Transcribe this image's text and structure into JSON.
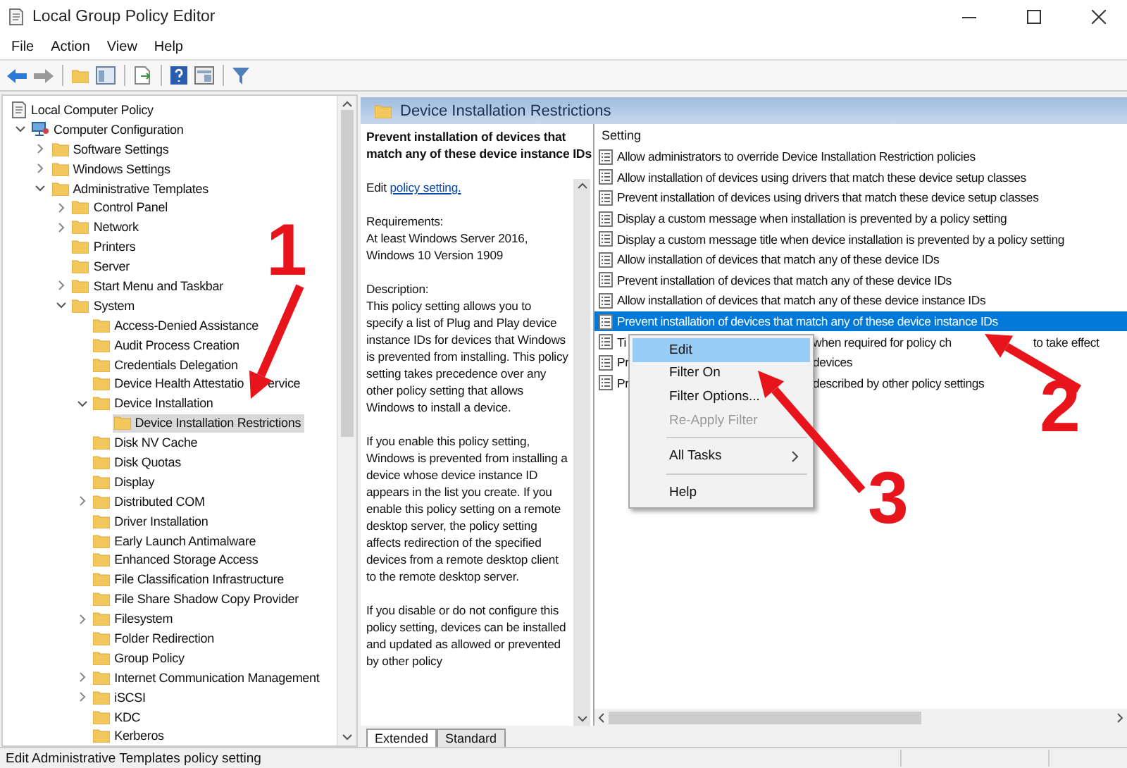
{
  "window": {
    "title": "Local Group Policy Editor"
  },
  "menu_bar": [
    "File",
    "Action",
    "View",
    "Help"
  ],
  "tree": [
    {
      "label": "Local Computer Policy",
      "kind": "policy",
      "selected": false,
      "children": [
        {
          "label": "Computer Configuration",
          "kind": "computer",
          "expanded": true,
          "selected": false,
          "children": [
            {
              "label": "Software Settings",
              "expanded": false,
              "selected": false
            },
            {
              "label": "Windows Settings",
              "expanded": false,
              "selected": false
            },
            {
              "label": "Administrative Templates",
              "expanded": true,
              "selected": false,
              "children": [
                {
                  "label": "Control Panel",
                  "expanded": false,
                  "selected": false
                },
                {
                  "label": "Network",
                  "expanded": false,
                  "selected": false
                },
                {
                  "label": "Printers",
                  "selected": false
                },
                {
                  "label": "Server",
                  "selected": false
                },
                {
                  "label": "Start Menu and Taskbar",
                  "expanded": false,
                  "selected": false
                },
                {
                  "label": "System",
                  "expanded": true,
                  "selected": false,
                  "children": [
                    {
                      "label": "Access-Denied Assistance",
                      "selected": false
                    },
                    {
                      "label": "Audit Process Creation",
                      "selected": false
                    },
                    {
                      "label": "Credentials Delegation",
                      "selected": false
                    },
                    {
                      "parts": [
                        "Device Health Attestatio",
                        "ervice"
                      ],
                      "selected": false
                    },
                    {
                      "label": "Device Installation",
                      "expanded": true,
                      "selected": false,
                      "children": [
                        {
                          "label": "Device Installation Restrictions",
                          "selected": true
                        }
                      ]
                    },
                    {
                      "label": "Disk NV Cache",
                      "selected": false
                    },
                    {
                      "label": "Disk Quotas",
                      "selected": false
                    },
                    {
                      "label": "Display",
                      "selected": false
                    },
                    {
                      "label": "Distributed COM",
                      "expanded": false,
                      "selected": false
                    },
                    {
                      "label": "Driver Installation",
                      "selected": false
                    },
                    {
                      "label": "Early Launch Antimalware",
                      "selected": false
                    },
                    {
                      "label": "Enhanced Storage Access",
                      "selected": false
                    },
                    {
                      "label": "File Classification Infrastructure",
                      "selected": false
                    },
                    {
                      "label": "File Share Shadow Copy Provider",
                      "selected": false
                    },
                    {
                      "label": "Filesystem",
                      "expanded": false,
                      "selected": false
                    },
                    {
                      "label": "Folder Redirection",
                      "selected": false
                    },
                    {
                      "label": "Group Policy",
                      "selected": false
                    },
                    {
                      "label": "Internet Communication Management",
                      "expanded": false,
                      "selected": false
                    },
                    {
                      "label": "iSCSI",
                      "expanded": false,
                      "selected": false
                    },
                    {
                      "label": "KDC",
                      "selected": false
                    },
                    {
                      "label": "Kerberos",
                      "selected": false
                    }
                  ]
                }
              ]
            }
          ]
        }
      ]
    }
  ],
  "right_pane": {
    "title": "Device Installation Restrictions",
    "description": {
      "heading": "Prevent installation of devices that match any of these device instance IDs",
      "edit_prefix": "Edit",
      "edit_link": "policy setting.",
      "requirements_label": "Requirements:",
      "requirements": "At least Windows Server 2016, Windows 10 Version 1909",
      "description_label": "Description:",
      "paragraphs": [
        "This policy setting allows you to specify a list of Plug and Play device instance IDs for devices that Windows is prevented from installing. This policy setting takes precedence over any other policy setting that allows Windows to install a device.",
        "If you enable this policy setting, Windows is prevented from installing a device whose device instance ID appears in the list you create. If you enable this policy setting on a remote desktop server, the policy setting affects redirection of the specified devices from a remote desktop client to the remote desktop server.",
        "If you disable or do not configure this policy setting, devices can be installed and updated as allowed or prevented by other policy"
      ]
    },
    "settings_header": "Setting",
    "settings": [
      {
        "parts": [
          "Allow administrators to override Device Installation Restriction policies"
        ],
        "selected": false
      },
      {
        "parts": [
          "Allow installation of devices using drivers that match these device setup classes"
        ],
        "selected": false
      },
      {
        "parts": [
          "Prevent installation of devices using drivers that match these device setup classes"
        ],
        "selected": false
      },
      {
        "parts": [
          "Display a custom message when installation is prevented by a policy setting"
        ],
        "selected": false
      },
      {
        "parts": [
          "Display a custom message title when device installation is prevented by a policy setting"
        ],
        "selected": false
      },
      {
        "parts": [
          "Allow installation of devices that match any of these device IDs"
        ],
        "selected": false
      },
      {
        "parts": [
          "Prevent installation of devices that match any of these device IDs"
        ],
        "selected": false
      },
      {
        "parts": [
          "Allow installation of devices that match any of these device instance IDs"
        ],
        "selected": false
      },
      {
        "parts": [
          "Prevent installation of devices that match any of these device instance IDs"
        ],
        "selected": true
      },
      {
        "parts": [
          "Ti",
          "when required for policy ch",
          "to take effect"
        ],
        "selected": false
      },
      {
        "parts": [
          "Pr",
          "devices"
        ],
        "selected": false
      },
      {
        "parts": [
          "Pr",
          "described by other policy settings"
        ],
        "selected": false
      }
    ],
    "tabs": [
      {
        "label": "Extended",
        "selected": true
      },
      {
        "label": "Standard",
        "selected": false
      }
    ]
  },
  "context_menu": [
    {
      "kind": "item",
      "label": "Edit",
      "selected": true,
      "disabled": false,
      "submenu": false
    },
    {
      "kind": "item",
      "label": "Filter On",
      "selected": false,
      "disabled": false,
      "submenu": false
    },
    {
      "kind": "item",
      "label": "Filter Options...",
      "selected": false,
      "disabled": false,
      "submenu": false
    },
    {
      "kind": "item",
      "label": "Re-Apply Filter",
      "selected": false,
      "disabled": true,
      "submenu": false
    },
    {
      "kind": "separator"
    },
    {
      "kind": "item",
      "label": "All Tasks",
      "selected": false,
      "disabled": false,
      "submenu": true
    },
    {
      "kind": "separator"
    },
    {
      "kind": "item",
      "label": "Help",
      "selected": false,
      "disabled": false,
      "submenu": false
    }
  ],
  "status_bar": {
    "text": "Edit Administrative Templates policy setting"
  },
  "annotations": [
    {
      "label": "1"
    },
    {
      "label": "2"
    },
    {
      "label": "3"
    }
  ]
}
